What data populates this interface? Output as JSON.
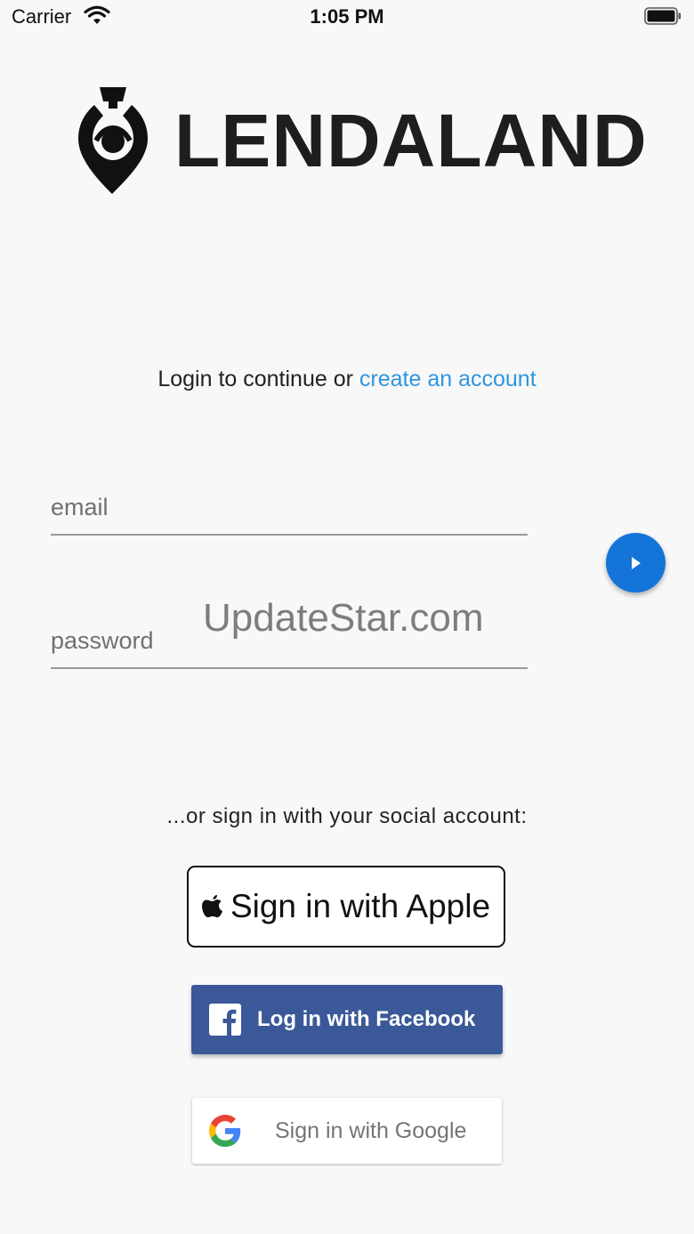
{
  "status_bar": {
    "carrier": "Carrier",
    "time": "1:05 PM",
    "icons": [
      "wifi-icon",
      "battery-icon"
    ]
  },
  "logo": {
    "icon": "location-pin-trophy-icon",
    "text": "LENDALAND"
  },
  "login": {
    "prompt": "Login to continue or ",
    "create_link": "create an account",
    "email_placeholder": "email",
    "password_placeholder": "password",
    "submit_icon": "play-arrow-icon"
  },
  "watermark": "UpdateStar.com",
  "social": {
    "prompt": "...or sign in with your social account:",
    "apple_label": "Sign in with Apple",
    "facebook_label": "Log in with Facebook",
    "google_label": "Sign in with Google"
  },
  "colors": {
    "accent_link": "#2e95de",
    "submit_button": "#1474d8",
    "facebook": "#3b5998",
    "background": "#f8f8f8"
  }
}
